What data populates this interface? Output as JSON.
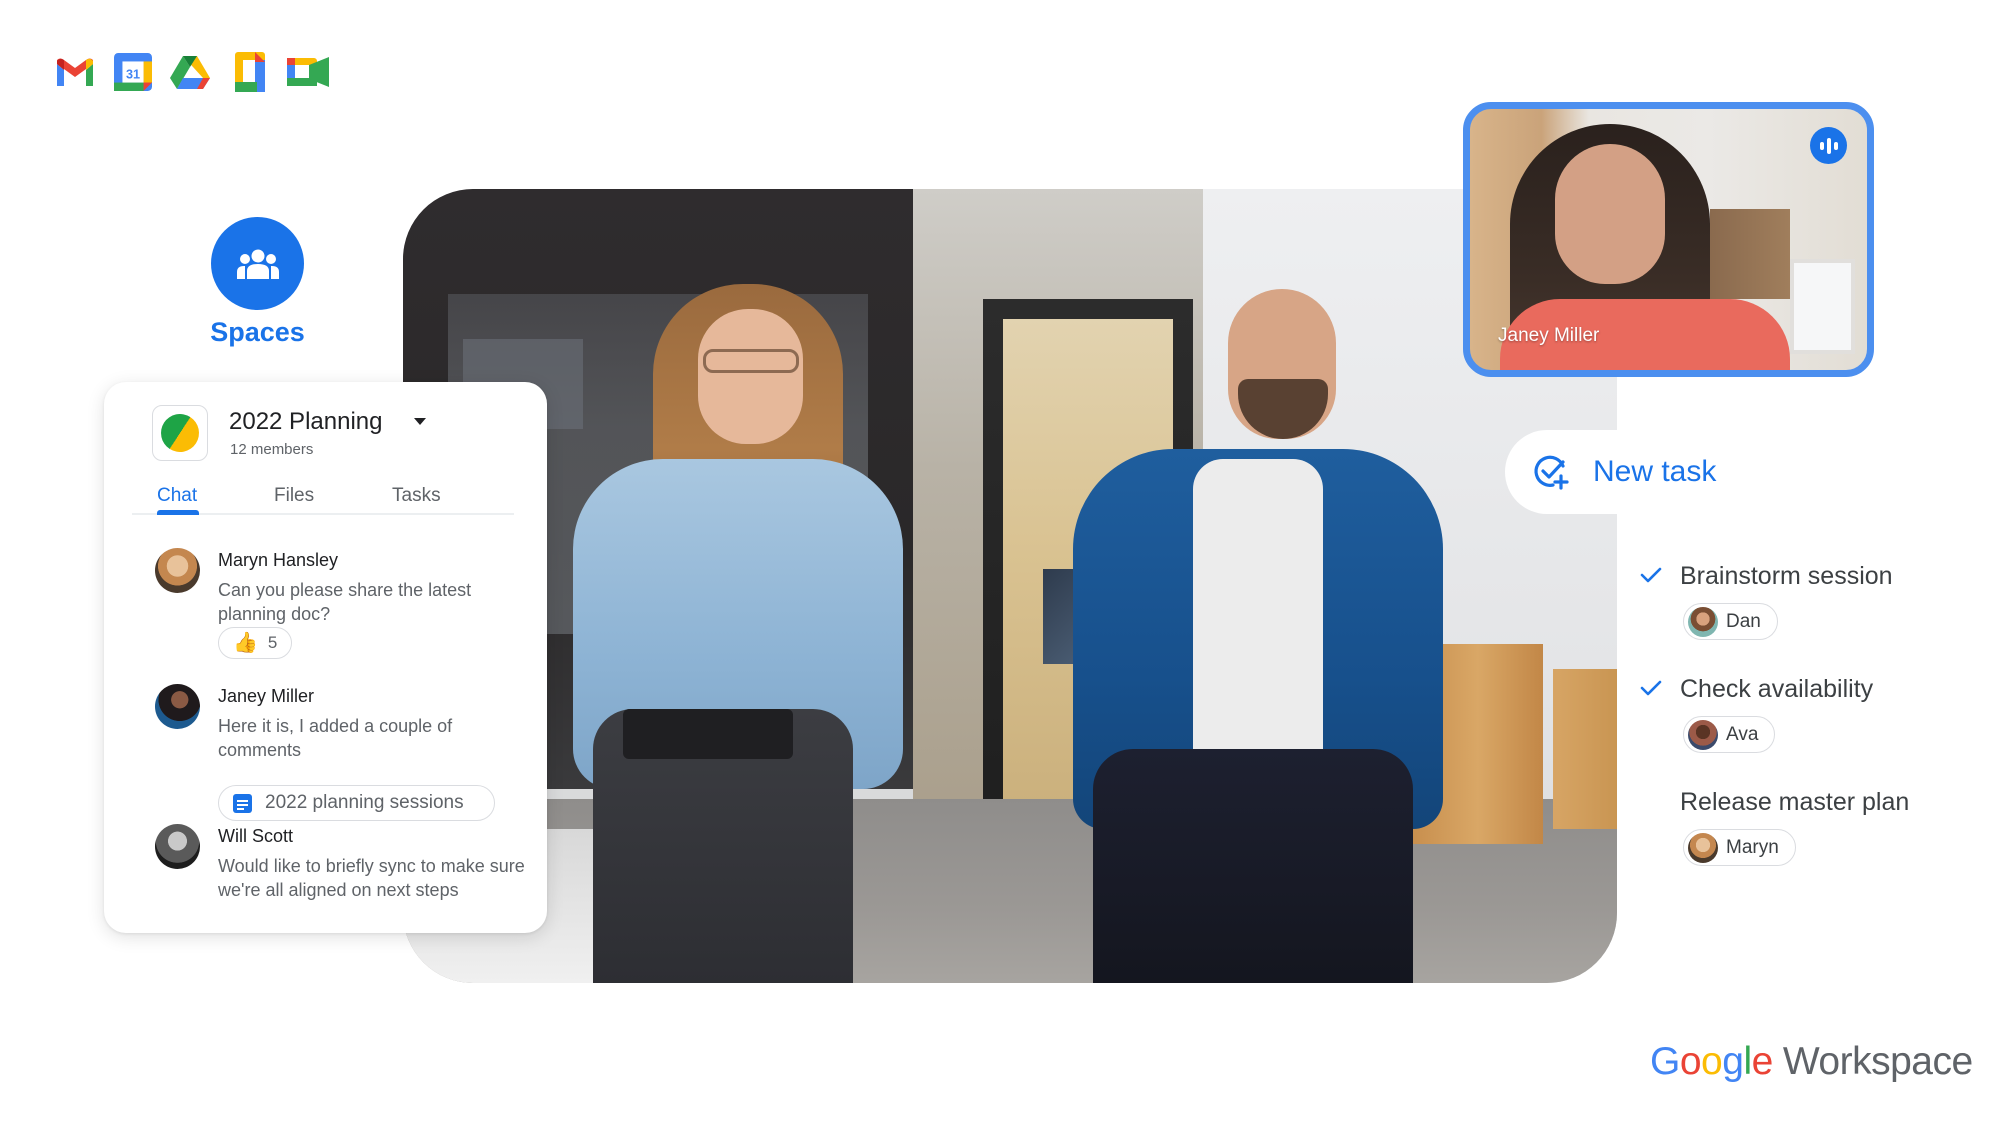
{
  "apps": [
    {
      "name": "Gmail",
      "icon": "gmail-icon"
    },
    {
      "name": "Calendar",
      "icon": "calendar-icon",
      "day": "31"
    },
    {
      "name": "Drive",
      "icon": "drive-icon"
    },
    {
      "name": "Docs",
      "icon": "docs-icon"
    },
    {
      "name": "Meet",
      "icon": "meet-icon"
    }
  ],
  "spaces": {
    "label": "Spaces",
    "icon": "people-icon",
    "color": "#1a73e8"
  },
  "chat_card": {
    "space_name": "2022 Planning",
    "members": "12 members",
    "tabs": [
      {
        "label": "Chat",
        "active": true
      },
      {
        "label": "Files",
        "active": false
      },
      {
        "label": "Tasks",
        "active": false
      }
    ],
    "messages": [
      {
        "author": "Maryn Hansley",
        "text": "Can you please share the latest planning doc?",
        "reaction": {
          "emoji": "thumbs-up",
          "count": "5"
        }
      },
      {
        "author": "Janey Miller",
        "text": "Here it is, I added a couple of comments",
        "attachment": {
          "icon": "docs-icon",
          "label": "2022 planning sessions"
        }
      },
      {
        "author": "Will Scott",
        "text": "Would like to briefly sync to make sure we're all aligned on next steps"
      }
    ]
  },
  "video_tile": {
    "participant": "Janey Miller",
    "status_icon": "speaking-indicator-icon",
    "border_color": "#4c8fef"
  },
  "tasks": {
    "new_task_label": "New task",
    "items": [
      {
        "title": "Brainstorm session",
        "done": true,
        "assignee": "Dan"
      },
      {
        "title": "Check availability",
        "done": true,
        "assignee": "Ava"
      },
      {
        "title": "Release master plan",
        "done": false,
        "assignee": "Maryn"
      }
    ]
  },
  "branding": {
    "google": "Google",
    "product": "Workspace",
    "google_colors": [
      "#4285f4",
      "#ea4335",
      "#fbbc04",
      "#4285f4",
      "#34a853",
      "#ea4335"
    ]
  },
  "accent_color": "#1a73e8"
}
